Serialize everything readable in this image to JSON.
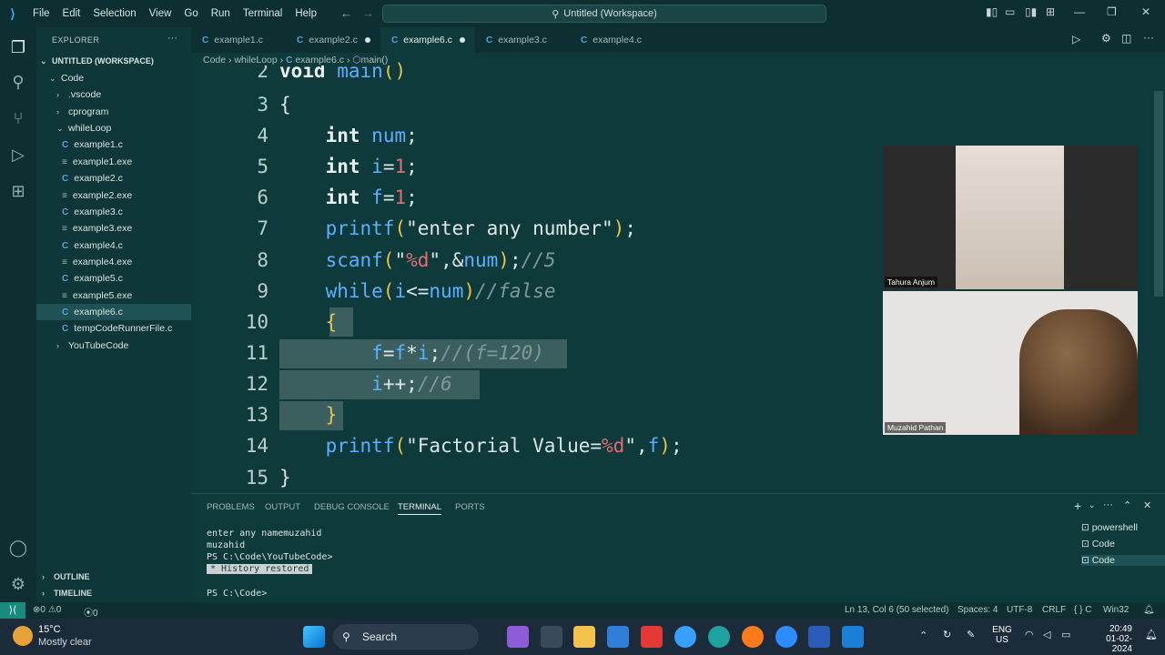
{
  "titlebar": {
    "menu": [
      "File",
      "Edit",
      "Selection",
      "View",
      "Go",
      "Run",
      "Terminal",
      "Help"
    ],
    "search": "Untitled (Workspace)"
  },
  "sidebar": {
    "header": "EXPLORER",
    "workspace": "UNTITLED (WORKSPACE)",
    "items": [
      {
        "label": "Code",
        "kind": "folder-open"
      },
      {
        "label": ".vscode",
        "kind": "folder"
      },
      {
        "label": "cprogram",
        "kind": "folder"
      },
      {
        "label": "whileLoop",
        "kind": "folder-open"
      },
      {
        "label": "example1.c",
        "kind": "c"
      },
      {
        "label": "example1.exe",
        "kind": "exe"
      },
      {
        "label": "example2.c",
        "kind": "c"
      },
      {
        "label": "example2.exe",
        "kind": "exe"
      },
      {
        "label": "example3.c",
        "kind": "c"
      },
      {
        "label": "example3.exe",
        "kind": "exe"
      },
      {
        "label": "example4.c",
        "kind": "c"
      },
      {
        "label": "example4.exe",
        "kind": "exe"
      },
      {
        "label": "example5.c",
        "kind": "c"
      },
      {
        "label": "example5.exe",
        "kind": "exe"
      },
      {
        "label": "example6.c",
        "kind": "c"
      },
      {
        "label": "tempCodeRunnerFile.c",
        "kind": "c"
      },
      {
        "label": "YouTubeCode",
        "kind": "folder"
      }
    ],
    "outline": "OUTLINE",
    "timeline": "TIMELINE"
  },
  "tabs": [
    "example1.c",
    "example2.c",
    "example6.c",
    "example3.c",
    "example4.c"
  ],
  "breadcrumb": [
    "Code",
    "whileLoop",
    "example6.c",
    "main()"
  ],
  "editor": {
    "line_numbers": [
      "2",
      "3",
      "4",
      "5",
      "6",
      "7",
      "8",
      "9",
      "10",
      "11",
      "12",
      "13",
      "14",
      "15"
    ],
    "lines": {
      "l2_kw": "void",
      "l2_fn": "main",
      "l2_rest": "()",
      "l3": "{",
      "l4_kw": "int",
      "l4_var": "num",
      "l4_end": ";",
      "l5_kw": "int",
      "l5_var": "i",
      "l5_eq": "=",
      "l5_num": "1",
      "l5_end": ";",
      "l6_kw": "int",
      "l6_var": "f",
      "l6_eq": "=",
      "l6_num": "1",
      "l6_end": ";",
      "l7_fn": "printf",
      "l7_p1": "(",
      "l7_str": "\"enter any number\"",
      "l7_p2": ")",
      "l7_end": ";",
      "l8_fn": "scanf",
      "l8_p1": "(",
      "l8_q1": "\"",
      "l8_fmt": "%d",
      "l8_q2": "\"",
      "l8_amp": ",&",
      "l8_var": "num",
      "l8_p2": ")",
      "l8_end": ";",
      "l8_cm": "//5",
      "l9_fn": "while",
      "l9_p1": "(",
      "l9_v1": "i",
      "l9_op": "<=",
      "l9_v2": "num",
      "l9_p2": ")",
      "l9_cm": "//false",
      "l10": "{",
      "l11_v1": "f",
      "l11_eq": "=",
      "l11_v2": "f",
      "l11_op": "*",
      "l11_v3": "i",
      "l11_end": ";",
      "l11_cm": "//(f=120)",
      "l12_v": "i",
      "l12_op": "++",
      "l12_end": ";",
      "l12_cm": "//6",
      "l13": "}",
      "l14_fn": "printf",
      "l14_p1": "(",
      "l14_q1": "\"Factorial Value=",
      "l14_fmt": "%d",
      "l14_q2": "\"",
      "l14_comma": ",",
      "l14_var": "f",
      "l14_p2": ")",
      "l14_end": ";",
      "l15": "}"
    }
  },
  "video": {
    "participant1": "Tahura Anjum",
    "participant2": "Muzahid Pathan"
  },
  "panel": {
    "tabs": [
      "PROBLEMS",
      "OUTPUT",
      "DEBUG CONSOLE",
      "TERMINAL",
      "PORTS"
    ],
    "active_tab": "TERMINAL",
    "terminal": [
      "enter any namemuzahid",
      "muzahid",
      "PS C:\\Code\\YouTubeCode>",
      "*  History restored",
      "PS C:\\Code>"
    ],
    "terminals": [
      "powershell",
      "Code",
      "Code"
    ]
  },
  "statusbar": {
    "problems": "0",
    "warnings": "0",
    "ports": "0",
    "position": "Ln 13, Col 6 (50 selected)",
    "spaces": "Spaces: 4",
    "encoding": "UTF-8",
    "eol": "CRLF",
    "language": "{ } C",
    "platform": "Win32"
  },
  "taskbar": {
    "weather_temp": "15°C",
    "weather_desc": "Mostly clear",
    "search": "Search",
    "lang1": "ENG",
    "lang2": "US",
    "time": "20:49",
    "date": "01-02-2024"
  },
  "colors": {
    "editor_bg": "#0f3a3c",
    "accent": "#1b8a7e",
    "keyword": "#e8f0ef",
    "identifier": "#5ab0ff",
    "number": "#e56b6f"
  }
}
